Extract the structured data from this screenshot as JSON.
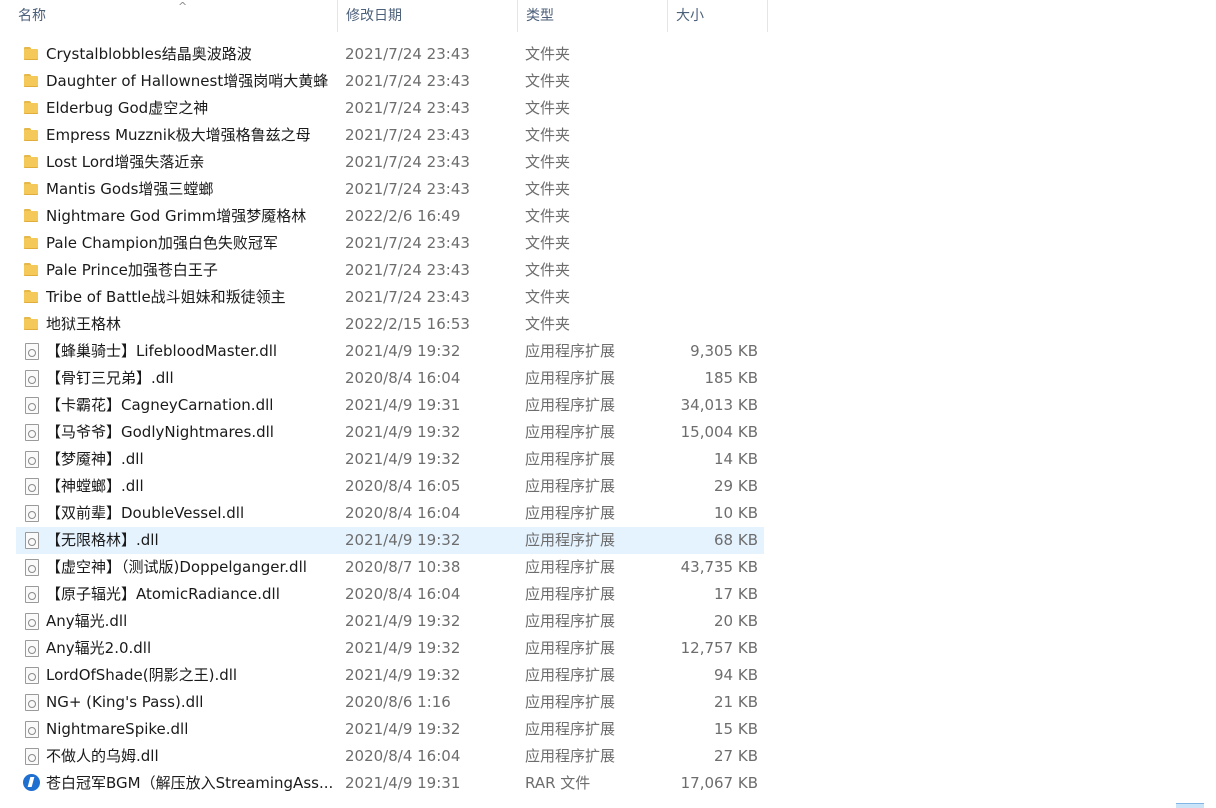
{
  "columns": {
    "name": "名称",
    "date": "修改日期",
    "type": "类型",
    "size": "大小"
  },
  "sort_indicator": "^",
  "files": [
    {
      "name": "Crystalblobbles结晶奥波路波",
      "date": "2021/7/24 23:43",
      "type": "文件夹",
      "size": "",
      "icon": "folder-icon"
    },
    {
      "name": "Daughter of Hallownest增强岗哨大黄蜂",
      "date": "2021/7/24 23:43",
      "type": "文件夹",
      "size": "",
      "icon": "folder-icon"
    },
    {
      "name": "Elderbug God虚空之神",
      "date": "2021/7/24 23:43",
      "type": "文件夹",
      "size": "",
      "icon": "folder-icon"
    },
    {
      "name": "Empress Muzznik极大增强格鲁兹之母",
      "date": "2021/7/24 23:43",
      "type": "文件夹",
      "size": "",
      "icon": "folder-icon"
    },
    {
      "name": "Lost Lord增强失落近亲",
      "date": "2021/7/24 23:43",
      "type": "文件夹",
      "size": "",
      "icon": "folder-icon"
    },
    {
      "name": "Mantis Gods增强三螳螂",
      "date": "2021/7/24 23:43",
      "type": "文件夹",
      "size": "",
      "icon": "folder-icon"
    },
    {
      "name": "Nightmare God Grimm增强梦魇格林",
      "date": "2022/2/6 16:49",
      "type": "文件夹",
      "size": "",
      "icon": "folder-icon"
    },
    {
      "name": "Pale Champion加强白色失败冠军",
      "date": "2021/7/24 23:43",
      "type": "文件夹",
      "size": "",
      "icon": "folder-icon"
    },
    {
      "name": "Pale Prince加强苍白王子",
      "date": "2021/7/24 23:43",
      "type": "文件夹",
      "size": "",
      "icon": "folder-icon"
    },
    {
      "name": "Tribe of Battle战斗姐妹和叛徒领主",
      "date": "2021/7/24 23:43",
      "type": "文件夹",
      "size": "",
      "icon": "folder-icon"
    },
    {
      "name": "地狱王格林",
      "date": "2022/2/15 16:53",
      "type": "文件夹",
      "size": "",
      "icon": "folder-icon"
    },
    {
      "name": "【蜂巢骑士】LifebloodMaster.dll",
      "date": "2021/4/9 19:32",
      "type": "应用程序扩展",
      "size": "9,305 KB",
      "icon": "dll-icon"
    },
    {
      "name": "【骨钉三兄弟】.dll",
      "date": "2020/8/4 16:04",
      "type": "应用程序扩展",
      "size": "185 KB",
      "icon": "dll-icon"
    },
    {
      "name": "【卡霸花】CagneyCarnation.dll",
      "date": "2021/4/9 19:31",
      "type": "应用程序扩展",
      "size": "34,013 KB",
      "icon": "dll-icon"
    },
    {
      "name": "【马爷爷】GodlyNightmares.dll",
      "date": "2021/4/9 19:32",
      "type": "应用程序扩展",
      "size": "15,004 KB",
      "icon": "dll-icon"
    },
    {
      "name": "【梦魇神】.dll",
      "date": "2021/4/9 19:32",
      "type": "应用程序扩展",
      "size": "14 KB",
      "icon": "dll-icon"
    },
    {
      "name": "【神螳螂】.dll",
      "date": "2020/8/4 16:05",
      "type": "应用程序扩展",
      "size": "29 KB",
      "icon": "dll-icon"
    },
    {
      "name": "【双前辈】DoubleVessel.dll",
      "date": "2020/8/4 16:04",
      "type": "应用程序扩展",
      "size": "10 KB",
      "icon": "dll-icon"
    },
    {
      "name": "【无限格林】.dll",
      "date": "2021/4/9 19:32",
      "type": "应用程序扩展",
      "size": "68 KB",
      "icon": "dll-icon",
      "selected": true
    },
    {
      "name": "【虚空神】（测试版)Doppelganger.dll",
      "date": "2020/8/7 10:38",
      "type": "应用程序扩展",
      "size": "43,735 KB",
      "icon": "dll-icon"
    },
    {
      "name": "【原子辐光】AtomicRadiance.dll",
      "date": "2020/8/4 16:04",
      "type": "应用程序扩展",
      "size": "17 KB",
      "icon": "dll-icon"
    },
    {
      "name": "Any辐光.dll",
      "date": "2021/4/9 19:32",
      "type": "应用程序扩展",
      "size": "20 KB",
      "icon": "dll-icon"
    },
    {
      "name": "Any辐光2.0.dll",
      "date": "2021/4/9 19:32",
      "type": "应用程序扩展",
      "size": "12,757 KB",
      "icon": "dll-icon"
    },
    {
      "name": "LordOfShade(阴影之王).dll",
      "date": "2021/4/9 19:32",
      "type": "应用程序扩展",
      "size": "94 KB",
      "icon": "dll-icon"
    },
    {
      "name": "NG+ (King's Pass).dll",
      "date": "2020/8/6 1:16",
      "type": "应用程序扩展",
      "size": "21 KB",
      "icon": "dll-icon"
    },
    {
      "name": "NightmareSpike.dll",
      "date": "2021/4/9 19:32",
      "type": "应用程序扩展",
      "size": "15 KB",
      "icon": "dll-icon"
    },
    {
      "name": "不做人的乌姆.dll",
      "date": "2020/8/4 16:04",
      "type": "应用程序扩展",
      "size": "27 KB",
      "icon": "dll-icon"
    },
    {
      "name": "苍白冠军BGM（解压放入StreamingAss...",
      "date": "2021/4/9 19:31",
      "type": "RAR 文件",
      "size": "17,067 KB",
      "icon": "rar-icon"
    }
  ]
}
